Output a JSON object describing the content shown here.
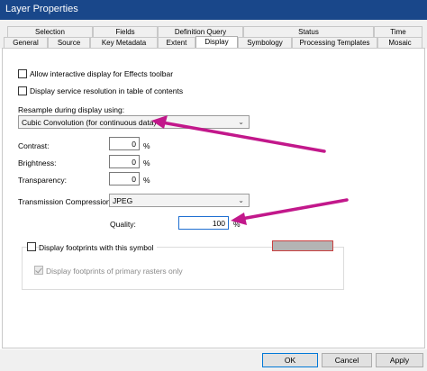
{
  "window": {
    "title": "Layer Properties"
  },
  "tabs": {
    "row_back": [
      "Selection",
      "Fields",
      "Definition Query",
      "Status",
      "Time"
    ],
    "row_front": [
      "General",
      "Source",
      "Key Metadata",
      "Extent",
      "Display",
      "Symbology",
      "Processing Templates",
      "Mosaic"
    ],
    "active": "Display"
  },
  "display": {
    "allow_effects_label": "Allow interactive display for Effects toolbar",
    "service_res_label": "Display service resolution in table of contents",
    "resample_label": "Resample during display using:",
    "resample_value": "Cubic Convolution (for continuous data)",
    "contrast_label": "Contrast:",
    "contrast_value": "0",
    "brightness_label": "Brightness:",
    "brightness_value": "0",
    "transparency_label": "Transparency:",
    "transparency_value": "0",
    "percent": "%",
    "compression_label": "Transmission Compression:",
    "compression_value": "JPEG",
    "quality_label": "Quality:",
    "quality_value": "100",
    "footprints_label": "Display footprints with this symbol",
    "footprints_primary_label": "Display footprints of primary rasters only"
  },
  "colors": {
    "titlebar": "#19478a",
    "annotation_arrow": "#c2188b",
    "swatch_fill": "#b4b4b4",
    "swatch_border": "#c94040"
  },
  "icons": {
    "dropdown": "chevron-down-icon",
    "checkmark": "check-icon"
  },
  "buttons": {
    "ok": "OK",
    "cancel": "Cancel",
    "apply": "Apply"
  }
}
